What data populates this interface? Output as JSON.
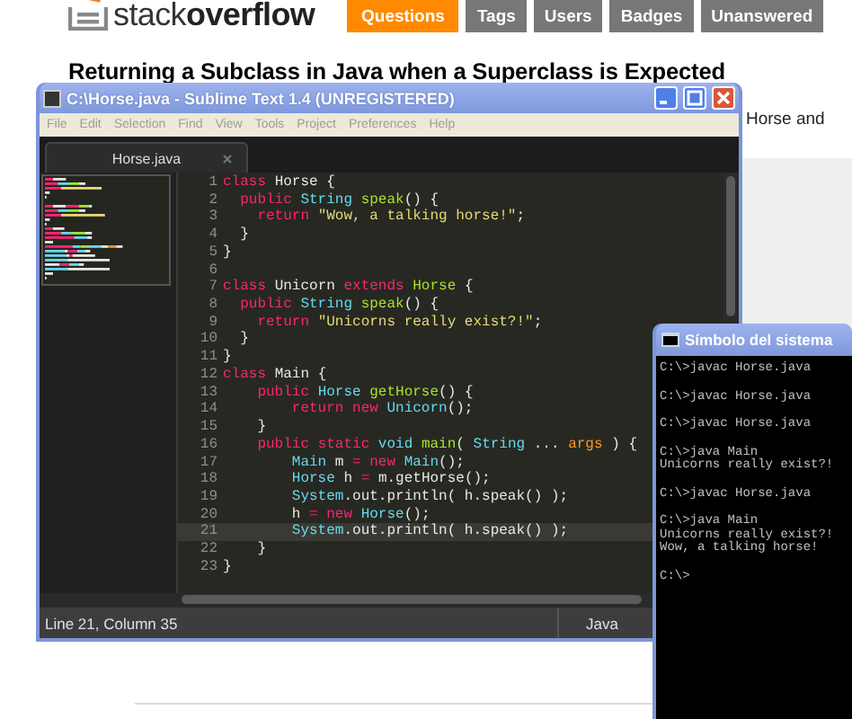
{
  "site": {
    "logo": "stack**overflow**",
    "nav": [
      {
        "label": "Questions",
        "selected": true
      },
      {
        "label": "Tags",
        "selected": false
      },
      {
        "label": "Users",
        "selected": false
      },
      {
        "label": "Badges",
        "selected": false
      },
      {
        "label": "Unanswered",
        "selected": false
      }
    ]
  },
  "question": {
    "title": "Returning a Subclass in Java when a Superclass is Expected",
    "excerpt": "Horse and"
  },
  "editor": {
    "title": "C:\\Horse.java - Sublime Text 1.4 (UNREGISTERED)",
    "menu": [
      "File",
      "Edit",
      "Selection",
      "Find",
      "View",
      "Tools",
      "Project",
      "Preferences",
      "Help"
    ],
    "tabs": [
      {
        "label": "Horse.java",
        "selected": true
      }
    ],
    "lines": [
      {
        "number": "1",
        "current": false,
        "tokens": [
          {
            "kind": "kw",
            "text": "class"
          },
          {
            "kind": "plain",
            "text": " Horse {"
          }
        ]
      },
      {
        "number": "2",
        "current": false,
        "tokens": [
          {
            "kind": "kw",
            "text": "  public"
          },
          {
            "kind": "type",
            "text": " String"
          },
          {
            "kind": "fn",
            "text": " speak"
          },
          {
            "kind": "plain",
            "text": "() {"
          }
        ]
      },
      {
        "number": "3",
        "current": false,
        "tokens": [
          {
            "kind": "kw",
            "text": "    return"
          },
          {
            "kind": "str",
            "text": " \"Wow, a talking horse!\""
          },
          {
            "kind": "plain",
            "text": ";"
          }
        ]
      },
      {
        "number": "4",
        "current": false,
        "tokens": [
          {
            "kind": "plain",
            "text": "  }"
          }
        ]
      },
      {
        "number": "5",
        "current": false,
        "tokens": [
          {
            "kind": "plain",
            "text": "}"
          }
        ]
      },
      {
        "number": "6",
        "current": false
      },
      {
        "number": "7",
        "current": false,
        "tokens": [
          {
            "kind": "kw",
            "text": "class"
          },
          {
            "kind": "plain",
            "text": " Unicorn"
          },
          {
            "kind": "kw",
            "text": " extends"
          },
          {
            "kind": "fn",
            "text": " Horse"
          },
          {
            "kind": "plain",
            "text": " {"
          }
        ]
      },
      {
        "number": "8",
        "current": false,
        "tokens": [
          {
            "kind": "kw",
            "text": "  public"
          },
          {
            "kind": "type",
            "text": " String"
          },
          {
            "kind": "fn",
            "text": " speak"
          },
          {
            "kind": "plain",
            "text": "() {"
          }
        ]
      },
      {
        "number": "9",
        "current": false,
        "tokens": [
          {
            "kind": "kw",
            "text": "    return"
          },
          {
            "kind": "str",
            "text": " \"Unicorns really exist?!\""
          },
          {
            "kind": "plain",
            "text": ";"
          }
        ]
      },
      {
        "number": "10",
        "current": false,
        "tokens": [
          {
            "kind": "plain",
            "text": "  }"
          }
        ]
      },
      {
        "number": "11",
        "current": false,
        "tokens": [
          {
            "kind": "plain",
            "text": "}"
          }
        ]
      },
      {
        "number": "12",
        "current": false,
        "tokens": [
          {
            "kind": "kw",
            "text": "class"
          },
          {
            "kind": "plain",
            "text": " Main {"
          }
        ]
      },
      {
        "number": "13",
        "current": false,
        "tokens": [
          {
            "kind": "kw",
            "text": "    public"
          },
          {
            "kind": "type",
            "text": " Horse"
          },
          {
            "kind": "fn",
            "text": " getHorse"
          },
          {
            "kind": "plain",
            "text": "() {"
          }
        ]
      },
      {
        "number": "14",
        "current": false,
        "tokens": [
          {
            "kind": "kw",
            "text": "        return"
          },
          {
            "kind": "kw",
            "text": " new"
          },
          {
            "kind": "type",
            "text": " Unicorn"
          },
          {
            "kind": "plain",
            "text": "();"
          }
        ]
      },
      {
        "number": "15",
        "current": false,
        "tokens": [
          {
            "kind": "plain",
            "text": "    }"
          }
        ]
      },
      {
        "number": "16",
        "current": false,
        "tokens": [
          {
            "kind": "kw",
            "text": "    public"
          },
          {
            "kind": "kw",
            "text": " static"
          },
          {
            "kind": "type",
            "text": " void"
          },
          {
            "kind": "fn",
            "text": " main"
          },
          {
            "kind": "plain",
            "text": "("
          },
          {
            "kind": "type",
            "text": " String"
          },
          {
            "kind": "plain",
            "text": " ..."
          },
          {
            "kind": "param",
            "text": " args"
          },
          {
            "kind": "plain",
            "text": " ) {"
          }
        ]
      },
      {
        "number": "17",
        "current": false,
        "tokens": [
          {
            "kind": "type",
            "text": "        Main"
          },
          {
            "kind": "plain",
            "text": " m"
          },
          {
            "kind": "kw",
            "text": " ="
          },
          {
            "kind": "kw",
            "text": " new"
          },
          {
            "kind": "type",
            "text": " Main"
          },
          {
            "kind": "plain",
            "text": "();"
          }
        ]
      },
      {
        "number": "18",
        "current": false,
        "tokens": [
          {
            "kind": "type",
            "text": "        Horse"
          },
          {
            "kind": "plain",
            "text": " h"
          },
          {
            "kind": "kw",
            "text": " ="
          },
          {
            "kind": "plain",
            "text": " m.getHorse();"
          }
        ]
      },
      {
        "number": "19",
        "current": false,
        "tokens": [
          {
            "kind": "type",
            "text": "        System"
          },
          {
            "kind": "plain",
            "text": ".out.println( h.speak() );"
          }
        ]
      },
      {
        "number": "20",
        "current": false,
        "tokens": [
          {
            "kind": "plain",
            "text": "        h"
          },
          {
            "kind": "kw",
            "text": " ="
          },
          {
            "kind": "kw",
            "text": " new"
          },
          {
            "kind": "type",
            "text": " Horse"
          },
          {
            "kind": "plain",
            "text": "();"
          }
        ]
      },
      {
        "number": "21",
        "current": true,
        "tokens": [
          {
            "kind": "type",
            "text": "        System"
          },
          {
            "kind": "plain",
            "text": ".out.println( h.speak() );"
          }
        ]
      },
      {
        "number": "22",
        "current": false,
        "tokens": [
          {
            "kind": "plain",
            "text": "    }"
          }
        ]
      },
      {
        "number": "23",
        "current": false,
        "tokens": [
          {
            "kind": "plain",
            "text": "}"
          }
        ]
      }
    ],
    "status": {
      "position": "Line 21, Column 35",
      "syntax": "Java"
    }
  },
  "console": {
    "title": "Símbolo del sistema",
    "blocks": [
      [
        "C:\\>javac Horse.java"
      ],
      [
        "C:\\>javac Horse.java"
      ],
      [
        "C:\\>javac Horse.java"
      ],
      [
        "C:\\>java Main",
        "Unicorns really exist?!"
      ],
      [
        "C:\\>javac Horse.java"
      ],
      [
        "C:\\>java Main",
        "Unicorns really exist?!",
        "Wow, a talking horse!"
      ],
      [
        "C:\\>"
      ]
    ]
  }
}
